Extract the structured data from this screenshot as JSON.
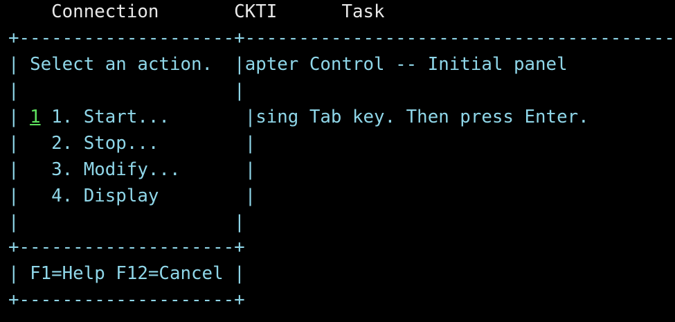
{
  "menubar": {
    "items": [
      "Connection",
      "CKTI",
      "Task"
    ]
  },
  "border": {
    "top": "+--------------------+------------------------------------------",
    "divider": "+--------------------+",
    "bottom": "+--------------------+",
    "vbar": "|"
  },
  "popup": {
    "title": "Select an action.",
    "selection_input": "1",
    "items": [
      "1. Start...",
      "2. Stop...",
      "3. Modify...",
      "4. Display"
    ],
    "function_keys": "F1=Help F12=Cancel"
  },
  "background_panel": {
    "title_fragment": "apter Control -- Initial panel",
    "instruction_fragment": "sing Tab key. Then press Enter."
  },
  "colors": {
    "background": "#000000",
    "text_cyan": "#8fd6e8",
    "text_white": "#e8e8e8",
    "input_green": "#5fe35f"
  }
}
